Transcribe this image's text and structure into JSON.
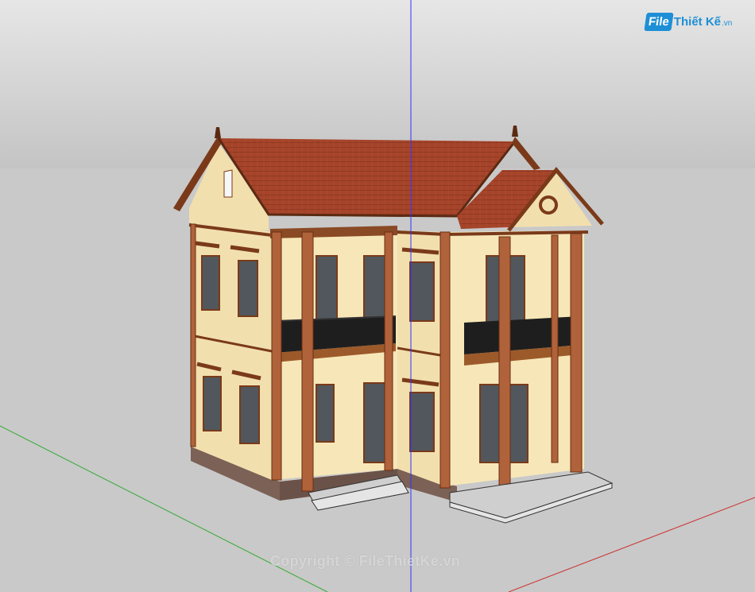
{
  "viewport": {
    "colors": {
      "sky_top": "#e6e6e6",
      "sky_bottom": "#c4c4c4",
      "ground": "#c9c9c9",
      "axis_blue": "#3232ff",
      "axis_green": "#33aa33",
      "axis_red": "#cc3333"
    }
  },
  "model": {
    "colors": {
      "roof": "#a5442a",
      "wall": "#f7e7b8",
      "wall_shade": "#ecd59a",
      "trim": "#7a3a1a",
      "column": "#b0623a",
      "railing": "#1e1e1e",
      "glass": "#51575c",
      "base": "#7b6156",
      "step": "#cfcfcf"
    }
  },
  "logo": {
    "box_text": "File",
    "main_text": "Thiết Kế",
    "ext_text": ".vn"
  },
  "watermark": {
    "text": "Copyright © FileThietKe.vn"
  }
}
